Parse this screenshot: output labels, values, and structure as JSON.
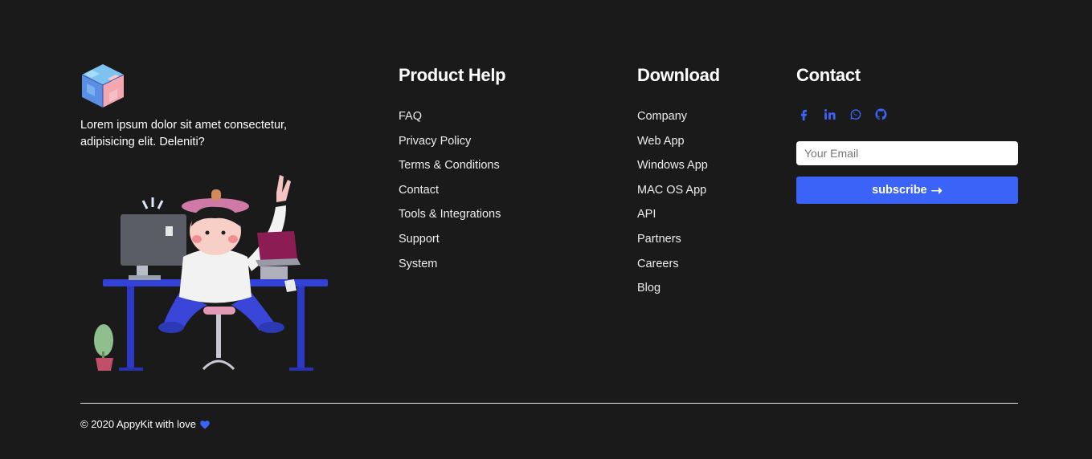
{
  "brand": {
    "logo_icon": "cube-logo-icon",
    "tagline": "Lorem ipsum dolor sit amet consectetur, adipisicing elit. Deleniti?",
    "illustration": "person-at-desk-illustration"
  },
  "product_help": {
    "title": "Product Help",
    "links": [
      "FAQ",
      "Privacy Policy",
      "Terms & Conditions",
      "Contact",
      "Tools & Integrations",
      "Support",
      "System"
    ]
  },
  "download": {
    "title": "Download",
    "links": [
      "Company",
      "Web App",
      "Windows App",
      "MAC OS App",
      "API",
      "Partners",
      "Careers",
      "Blog"
    ]
  },
  "contact": {
    "title": "Contact",
    "socials": [
      "facebook-icon",
      "linkedin-icon",
      "whatsapp-icon",
      "github-icon"
    ],
    "email_placeholder": "Your Email",
    "email_value": "",
    "subscribe_label": "subscribe",
    "subscribe_icon": "arrow-right-icon"
  },
  "footer": {
    "copyright": "© 2020 AppyKit with love",
    "heart_icon": "heart-icon"
  },
  "colors": {
    "background": "#1a1a1a",
    "accent": "#3b63f7",
    "text": "#ffffff"
  }
}
